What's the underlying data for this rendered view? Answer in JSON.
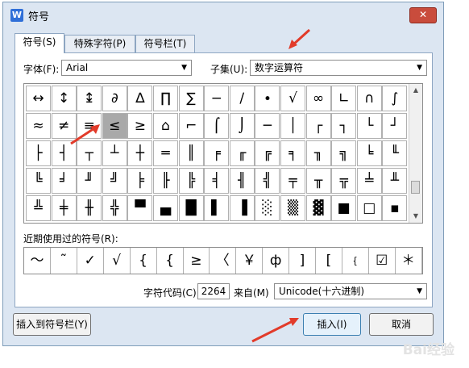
{
  "window": {
    "title": "符号",
    "close_symbol": "✕"
  },
  "tabs": [
    {
      "label": "符号(S)"
    },
    {
      "label": "特殊字符(P)"
    },
    {
      "label": "符号栏(T)"
    }
  ],
  "font": {
    "label": "字体(F):",
    "value": "Arial"
  },
  "subset": {
    "label": "子集(U):",
    "value": "数字运算符"
  },
  "symbol_grid": [
    [
      "↔",
      "↕",
      "↨",
      "∂",
      "∆",
      "∏",
      "∑",
      "−",
      "∕",
      "∙",
      "√",
      "∞",
      "∟",
      "∩",
      "∫"
    ],
    [
      "≈",
      "≠",
      "≡",
      "≤",
      "≥",
      "⌂",
      "⌐",
      "⌠",
      "⌡",
      "─",
      "│",
      "┌",
      "┐",
      "└",
      "┘"
    ],
    [
      "├",
      "┤",
      "┬",
      "┴",
      "┼",
      "═",
      "║",
      "╒",
      "╓",
      "╔",
      "╕",
      "╖",
      "╗",
      "╘",
      "╙"
    ],
    [
      "╚",
      "╛",
      "╜",
      "╝",
      "╞",
      "╟",
      "╠",
      "╡",
      "╢",
      "╣",
      "╤",
      "╥",
      "╦",
      "╧",
      "╨"
    ],
    [
      "╩",
      "╪",
      "╫",
      "╬",
      "▀",
      "▄",
      "█",
      "▌",
      "▐",
      "░",
      "▒",
      "▓",
      "■",
      "□",
      "▪"
    ]
  ],
  "selected_symbol": "≤",
  "recent": {
    "label": "近期使用过的符号(R):",
    "symbols": [
      "～",
      "˜",
      "✓",
      "√",
      "{",
      "{",
      "≥",
      "〈",
      "￥",
      "ф",
      "]",
      "[",
      "﹛",
      "☑",
      "＊"
    ]
  },
  "char_code": {
    "label": "字符代码(C):",
    "value": "2264"
  },
  "from": {
    "label": "来自(M)",
    "value": "Unicode(十六进制)"
  },
  "buttons": {
    "add_to_bar": "插入到符号栏(Y)",
    "insert": "插入(I)",
    "cancel": "取消"
  },
  "watermark": "Bai经验"
}
